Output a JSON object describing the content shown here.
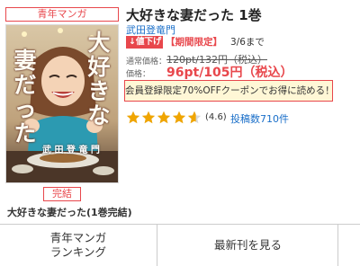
{
  "genre_label": "青年マンガ",
  "cover": {
    "title_right": [
      "大",
      "好",
      "き",
      "な"
    ],
    "title_left": [
      "妻",
      "だ",
      "っ",
      "た"
    ],
    "author": "武 田 登 竜 門"
  },
  "complete_badge": "完結",
  "series_title": "大好きな妻だった(1巻完結)",
  "book": {
    "title": "大好きな妻だった 1巻",
    "author": "武田登竜門"
  },
  "promo": {
    "price_down_label": "↓値下げ",
    "limited_label": "【期間限定】",
    "limited_until": "3/6まで"
  },
  "price": {
    "regular_label": "通常価格：",
    "regular_value": "120pt/132円（税込）",
    "sale_label": "価格：",
    "sale_value": "96pt/105円（税込）"
  },
  "coupon_text": "会員登録限定70%OFFクーポンでお得に読める！",
  "rating": {
    "stars": 4.6,
    "max_stars": 5,
    "value_text": "(4.6)",
    "reviews_text": "投稿数710件"
  },
  "bottom_nav": {
    "ranking_line1": "青年マンガ",
    "ranking_line2": "ランキング",
    "latest": "最新刊を見る"
  },
  "colors": {
    "accent_red": "#e8474c",
    "link_blue": "#1a6fc9",
    "star_gold": "#f0a500",
    "coupon_bg": "#fff7d6"
  }
}
